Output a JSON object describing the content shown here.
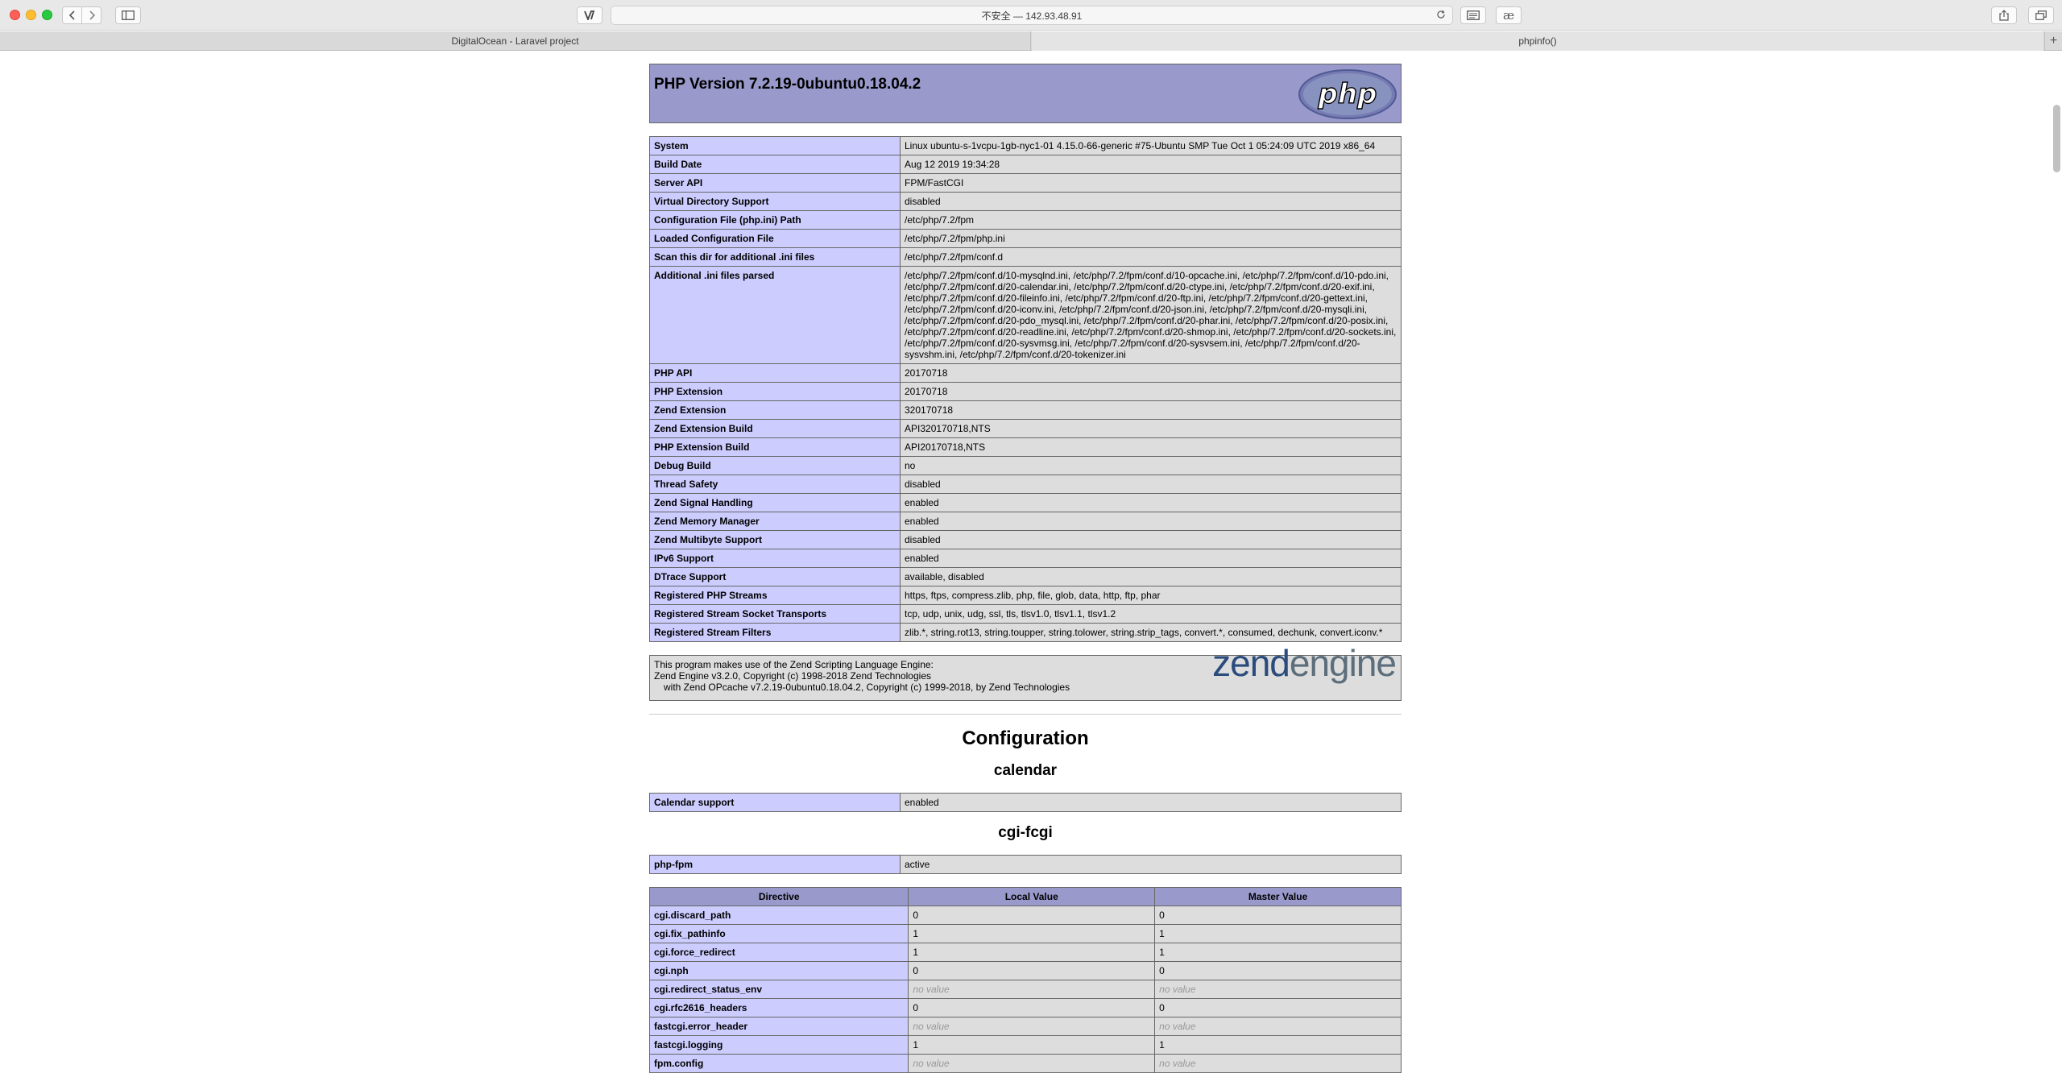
{
  "browser": {
    "url_display": "不安全 — 142.93.48.91",
    "tabs": [
      {
        "label": "DigitalOcean - Laravel project"
      },
      {
        "label": "phpinfo()"
      }
    ],
    "new_tab_symbol": "+",
    "ext2_symbol": "æ",
    "icons": [
      "back-arrow-icon",
      "forward-arrow-icon",
      "sidebar-icon",
      "extension-icon",
      "reload-icon",
      "reader-icon",
      "share-icon",
      "tabs-overview-icon"
    ]
  },
  "phpinfo": {
    "title": "PHP Version 7.2.19-0ubuntu0.18.04.2",
    "logo_text": "php",
    "general_rows": [
      {
        "name": "System",
        "value": "Linux ubuntu-s-1vcpu-1gb-nyc1-01 4.15.0-66-generic #75-Ubuntu SMP Tue Oct 1 05:24:09 UTC 2019 x86_64"
      },
      {
        "name": "Build Date",
        "value": "Aug 12 2019 19:34:28"
      },
      {
        "name": "Server API",
        "value": "FPM/FastCGI"
      },
      {
        "name": "Virtual Directory Support",
        "value": "disabled"
      },
      {
        "name": "Configuration File (php.ini) Path",
        "value": "/etc/php/7.2/fpm"
      },
      {
        "name": "Loaded Configuration File",
        "value": "/etc/php/7.2/fpm/php.ini"
      },
      {
        "name": "Scan this dir for additional .ini files",
        "value": "/etc/php/7.2/fpm/conf.d"
      },
      {
        "name": "Additional .ini files parsed",
        "value": "/etc/php/7.2/fpm/conf.d/10-mysqlnd.ini, /etc/php/7.2/fpm/conf.d/10-opcache.ini, /etc/php/7.2/fpm/conf.d/10-pdo.ini, /etc/php/7.2/fpm/conf.d/20-calendar.ini, /etc/php/7.2/fpm/conf.d/20-ctype.ini, /etc/php/7.2/fpm/conf.d/20-exif.ini, /etc/php/7.2/fpm/conf.d/20-fileinfo.ini, /etc/php/7.2/fpm/conf.d/20-ftp.ini, /etc/php/7.2/fpm/conf.d/20-gettext.ini, /etc/php/7.2/fpm/conf.d/20-iconv.ini, /etc/php/7.2/fpm/conf.d/20-json.ini, /etc/php/7.2/fpm/conf.d/20-mysqli.ini, /etc/php/7.2/fpm/conf.d/20-pdo_mysql.ini, /etc/php/7.2/fpm/conf.d/20-phar.ini, /etc/php/7.2/fpm/conf.d/20-posix.ini, /etc/php/7.2/fpm/conf.d/20-readline.ini, /etc/php/7.2/fpm/conf.d/20-shmop.ini, /etc/php/7.2/fpm/conf.d/20-sockets.ini, /etc/php/7.2/fpm/conf.d/20-sysvmsg.ini, /etc/php/7.2/fpm/conf.d/20-sysvsem.ini, /etc/php/7.2/fpm/conf.d/20-sysvshm.ini, /etc/php/7.2/fpm/conf.d/20-tokenizer.ini"
      },
      {
        "name": "PHP API",
        "value": "20170718"
      },
      {
        "name": "PHP Extension",
        "value": "20170718"
      },
      {
        "name": "Zend Extension",
        "value": "320170718"
      },
      {
        "name": "Zend Extension Build",
        "value": "API320170718,NTS"
      },
      {
        "name": "PHP Extension Build",
        "value": "API20170718,NTS"
      },
      {
        "name": "Debug Build",
        "value": "no"
      },
      {
        "name": "Thread Safety",
        "value": "disabled"
      },
      {
        "name": "Zend Signal Handling",
        "value": "enabled"
      },
      {
        "name": "Zend Memory Manager",
        "value": "enabled"
      },
      {
        "name": "Zend Multibyte Support",
        "value": "disabled"
      },
      {
        "name": "IPv6 Support",
        "value": "enabled"
      },
      {
        "name": "DTrace Support",
        "value": "available, disabled"
      },
      {
        "name": "Registered PHP Streams",
        "value": "https, ftps, compress.zlib, php, file, glob, data, http, ftp, phar"
      },
      {
        "name": "Registered Stream Socket Transports",
        "value": "tcp, udp, unix, udg, ssl, tls, tlsv1.0, tlsv1.1, tlsv1.2"
      },
      {
        "name": "Registered Stream Filters",
        "value": "zlib.*, string.rot13, string.toupper, string.tolower, string.strip_tags, convert.*, consumed, dechunk, convert.iconv.*"
      }
    ],
    "zend": {
      "line1": "This program makes use of the Zend Scripting Language Engine:",
      "line2": "Zend Engine v3.2.0, Copyright (c) 1998-2018 Zend Technologies",
      "line3": "with Zend OPcache v7.2.19-0ubuntu0.18.04.2, Copyright (c) 1999-2018, by Zend Technologies",
      "logo_zend": "zend",
      "logo_engine": "engine"
    },
    "configuration_heading": "Configuration",
    "calendar": {
      "heading": "calendar",
      "rows": [
        {
          "name": "Calendar support",
          "value": "enabled"
        }
      ]
    },
    "cgi": {
      "heading": "cgi-fcgi",
      "rows": [
        {
          "name": "php-fpm",
          "value": "active"
        }
      ],
      "table_headers": {
        "directive": "Directive",
        "local": "Local Value",
        "master": "Master Value"
      },
      "directives": [
        {
          "name": "cgi.discard_path",
          "local": "0",
          "master": "0",
          "novalue": false
        },
        {
          "name": "cgi.fix_pathinfo",
          "local": "1",
          "master": "1",
          "novalue": false
        },
        {
          "name": "cgi.force_redirect",
          "local": "1",
          "master": "1",
          "novalue": false
        },
        {
          "name": "cgi.nph",
          "local": "0",
          "master": "0",
          "novalue": false
        },
        {
          "name": "cgi.redirect_status_env",
          "local": "no value",
          "master": "no value",
          "novalue": true
        },
        {
          "name": "cgi.rfc2616_headers",
          "local": "0",
          "master": "0",
          "novalue": false
        },
        {
          "name": "fastcgi.error_header",
          "local": "no value",
          "master": "no value",
          "novalue": true
        },
        {
          "name": "fastcgi.logging",
          "local": "1",
          "master": "1",
          "novalue": false
        },
        {
          "name": "fpm.config",
          "local": "no value",
          "master": "no value",
          "novalue": true
        }
      ]
    }
  }
}
